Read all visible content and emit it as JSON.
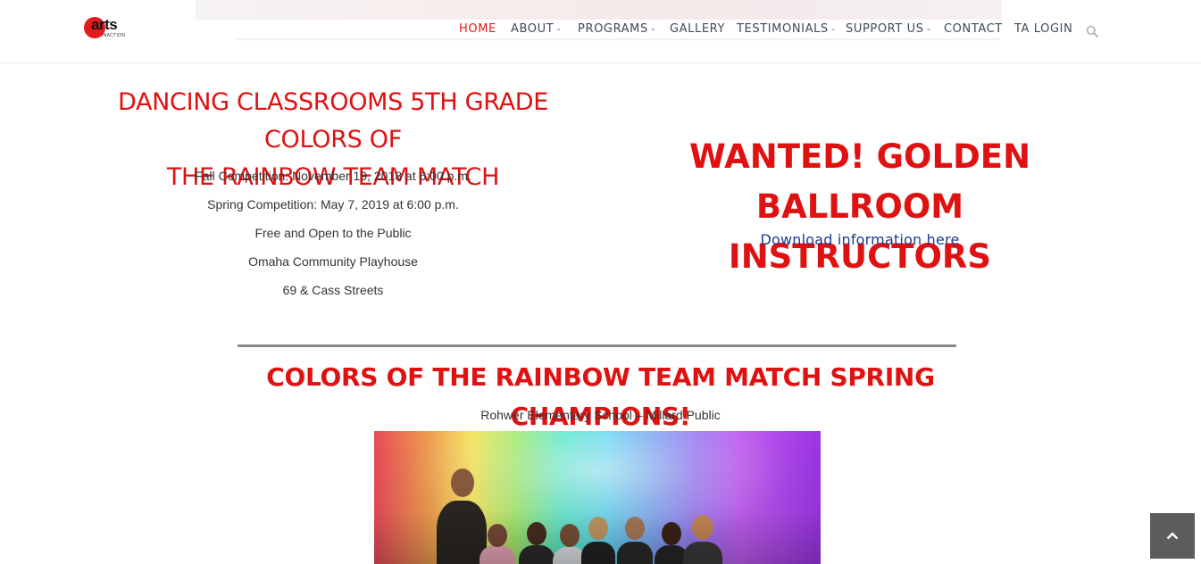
{
  "header": {
    "logo_text": "arts",
    "logo_subtext": "INACTION",
    "nav": [
      {
        "label": "HOME",
        "active": true,
        "dropdown": false
      },
      {
        "label": "ABOUT",
        "active": false,
        "dropdown": true
      },
      {
        "label": "PROGRAMS",
        "active": false,
        "dropdown": true
      },
      {
        "label": "GALLERY",
        "active": false,
        "dropdown": false
      },
      {
        "label": "TESTIMONIALS",
        "active": false,
        "dropdown": true
      },
      {
        "label": "SUPPORT US",
        "active": false,
        "dropdown": true
      },
      {
        "label": "CONTACT",
        "active": false,
        "dropdown": false
      },
      {
        "label": "TA LOGIN",
        "active": false,
        "dropdown": false
      }
    ],
    "search_icon": "search-icon"
  },
  "left_section": {
    "title_line1": "DANCING CLASSROOMS 5TH GRADE COLORS OF",
    "title_line2": "THE RAINBOW TEAM MATCH",
    "details": [
      "Fall Competition: November 19, 2018 at 6:00 p.m.",
      "Spring Competition: May 7, 2019 at 6:00 p.m.",
      "Free and Open to the Public",
      "Omaha Community Playhouse",
      "69 & Cass Streets"
    ]
  },
  "right_section": {
    "title_line1": "WANTED! GOLDEN BALLROOM",
    "title_line2": "INSTRUCTORS",
    "link_text": "Download information here"
  },
  "champions": {
    "title": "COLORS OF THE RAINBOW TEAM MATCH SPRING CHAMPIONS!",
    "school": "Rohwer Elementary School – Millard Public"
  },
  "colors": {
    "accent_red": "#e01111",
    "link_blue": "#1d3a8f",
    "nav_text": "#3f4a5a"
  },
  "back_to_top_icon": "chevron-up-icon"
}
